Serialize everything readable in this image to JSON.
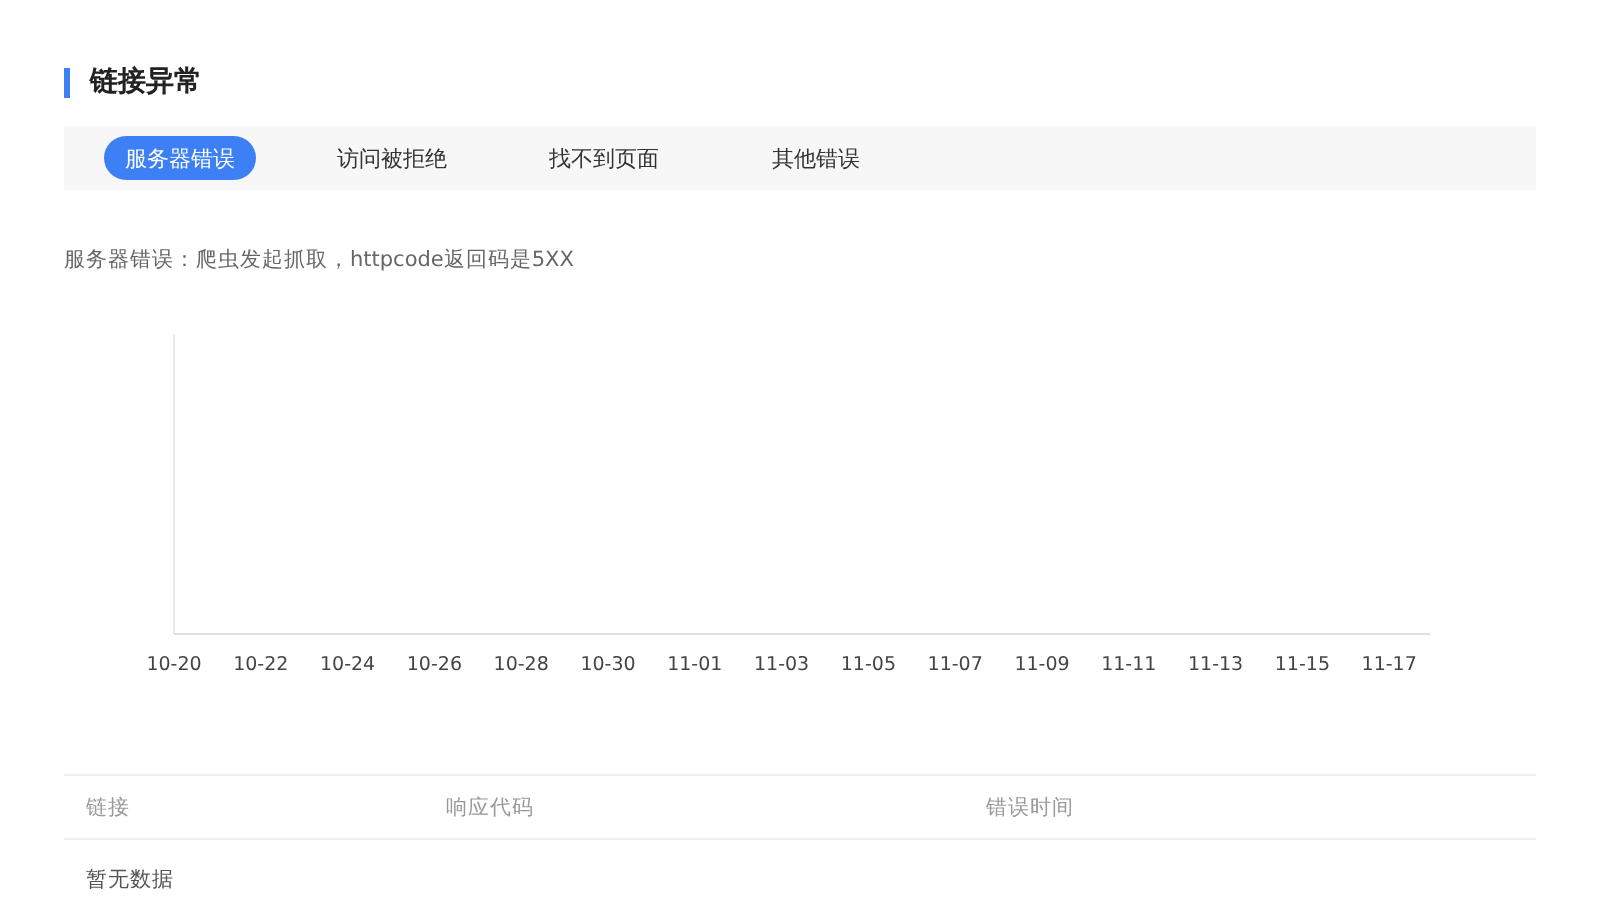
{
  "title": "链接异常",
  "tabs": [
    {
      "label": "服务器错误",
      "selected": true
    },
    {
      "label": "访问被拒绝",
      "selected": false
    },
    {
      "label": "找不到页面",
      "selected": false
    },
    {
      "label": "其他错误",
      "selected": false
    }
  ],
  "description": "服务器错误：爬虫发起抓取，httpcode返回码是5XX",
  "chart": {
    "chart_data": {
      "type": "other",
      "categories": [
        "10-20",
        "10-22",
        "10-24",
        "10-26",
        "10-28",
        "10-30",
        "11-01",
        "11-03",
        "11-05",
        "11-07",
        "11-09",
        "11-11",
        "11-13",
        "11-15",
        "11-17"
      ]
    }
  },
  "table": {
    "columns": [
      "链接",
      "响应代码",
      "错误时间"
    ],
    "empty_text": "暂无数据"
  }
}
